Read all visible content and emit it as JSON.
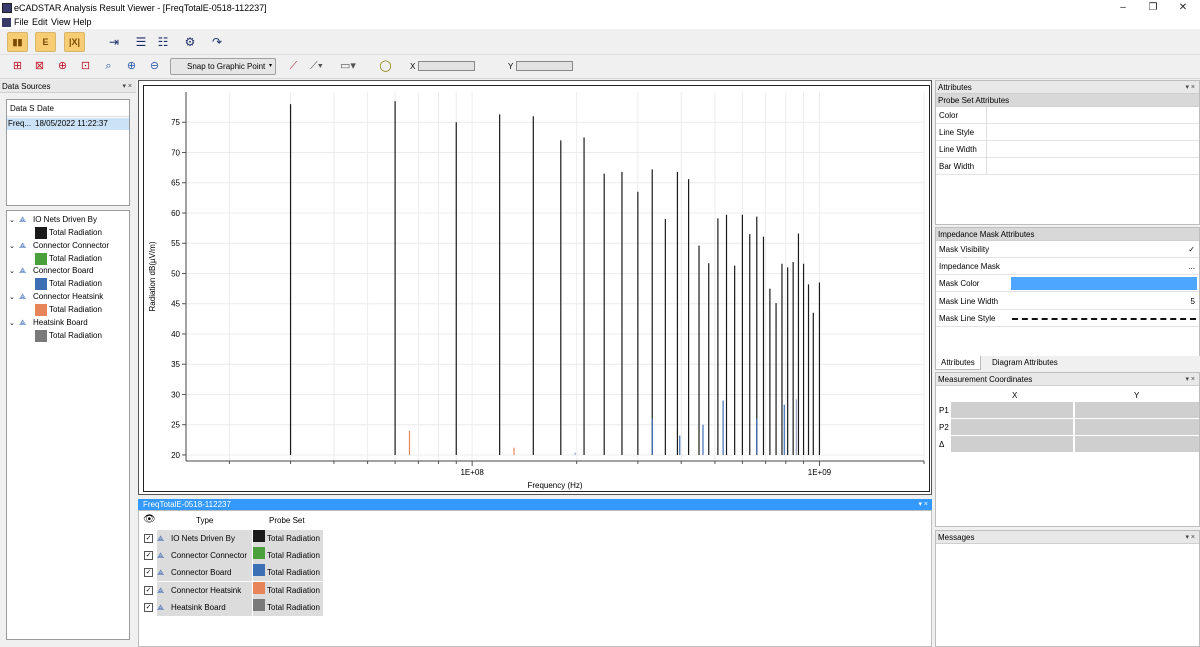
{
  "window": {
    "title": "eCADSTAR Analysis Result Viewer - [FreqTotalE-0518-112237]",
    "controls": [
      "–",
      "❐",
      "✕"
    ]
  },
  "menu": [
    "File",
    "Edit",
    "View",
    "Help"
  ],
  "toolbar2": {
    "snap_label": "Snap to Graphic Point",
    "x_label": "X",
    "y_label": "Y",
    "x_value": "",
    "y_value": ""
  },
  "data_sources": {
    "header": "Data Sources",
    "columns": [
      "Data S",
      "Date"
    ],
    "rows": [
      {
        "name": "Freq...",
        "date": "18/05/2022 11:22:37"
      }
    ]
  },
  "tree": [
    {
      "label": "IO Nets Driven By",
      "child": "Total Radiation",
      "color": "#1a1a1a"
    },
    {
      "label": "Connector Connector",
      "child": "Total Radiation",
      "color": "#4aa03a"
    },
    {
      "label": "Connector Board",
      "child": "Total Radiation",
      "color": "#3d6fb5"
    },
    {
      "label": "Connector Heatsink",
      "child": "Total Radiation",
      "color": "#e8845a"
    },
    {
      "label": "Heatsink Board",
      "child": "Total Radiation",
      "color": "#7a7a7a"
    }
  ],
  "chart_data": {
    "type": "bar",
    "xlabel": "Frequency (Hz)",
    "ylabel": "Radiation dB(µV/m)",
    "xscale": "log",
    "xlim": [
      15000000,
      2000000000
    ],
    "ylim": [
      19,
      80
    ],
    "xticks": [
      {
        "value": 100000000,
        "label": "1E+08"
      },
      {
        "value": 1000000000,
        "label": "1E+09"
      }
    ],
    "yticks": [
      20,
      25,
      30,
      35,
      40,
      45,
      50,
      55,
      60,
      65,
      70,
      75
    ],
    "grid": true,
    "series": [
      {
        "color": "#1a1a1a",
        "x": [
          30000000,
          60000000,
          90000000,
          120000000,
          150000000,
          180000000,
          210000000,
          240000000,
          270000000,
          300000000,
          330000000,
          360000000,
          390000000,
          420000000,
          450000000,
          480000000,
          510000000,
          540000000,
          570000000,
          600000000,
          630000000,
          660000000,
          690000000,
          720000000,
          750000000,
          780000000,
          810000000,
          840000000,
          870000000,
          900000000,
          930000000,
          960000000,
          1000000000
        ],
        "values": [
          78,
          78.5,
          75,
          76.3,
          76,
          72,
          72.5,
          66.5,
          66.8,
          63.5,
          67.2,
          59,
          66.8,
          65.6,
          54.6,
          51.7,
          59.1,
          59.7,
          51.3,
          59.7,
          56.5,
          59.4,
          56.1,
          47.5,
          45.1,
          51.6,
          51,
          51.9,
          56.6,
          51.6,
          48.2,
          43.5,
          48.5
        ]
      },
      {
        "color": "#e8845a",
        "x": [
          66000000,
          132000000
        ],
        "values": [
          24,
          21.2
        ]
      },
      {
        "color": "#3d6fb5",
        "x": [
          330000000,
          396000000,
          462000000,
          528000000,
          660000000,
          792000000
        ],
        "values": [
          26,
          23.2,
          25,
          29,
          26,
          28.3
        ]
      },
      {
        "color": "#9aa8c8",
        "x": [
          198000000,
          858000000
        ],
        "values": [
          20.4,
          29.2
        ]
      }
    ]
  },
  "bottom_table": {
    "header": "FreqTotalE-0518-112237",
    "col_type": "Type",
    "col_probe": "Probe Set",
    "rows": [
      {
        "type": "IO Nets Driven By",
        "probe": "Total Radiation",
        "color": "#1a1a1a",
        "checked": "✓"
      },
      {
        "type": "Connector Connector",
        "probe": "Total Radiation",
        "color": "#4aa03a",
        "checked": "✓"
      },
      {
        "type": "Connector Board",
        "probe": "Total Radiation",
        "color": "#3d6fb5",
        "checked": "✓"
      },
      {
        "type": "Connector Heatsink",
        "probe": "Total Radiation",
        "color": "#e8845a",
        "checked": "✓"
      },
      {
        "type": "Heatsink Board",
        "probe": "Total Radiation",
        "color": "#7a7a7a",
        "checked": "✓"
      }
    ]
  },
  "attributes": {
    "header": "Attributes",
    "section": "Probe Set Attributes",
    "rows": [
      "Color",
      "Line Style",
      "Line Width",
      "Bar Width"
    ]
  },
  "impedance": {
    "header": "Impedance Mask Attributes",
    "rows": [
      {
        "label": "Mask Visibility",
        "value": "✓"
      },
      {
        "label": "Impedance Mask",
        "value": "..."
      },
      {
        "label": "Mask Color",
        "value": ""
      },
      {
        "label": "Mask Line Width",
        "value": "5"
      },
      {
        "label": "Mask Line Style",
        "value": ""
      }
    ],
    "mask_color": "#4da6ff"
  },
  "tabs": [
    "Attributes",
    "Diagram Attributes"
  ],
  "measurement": {
    "header": "Measurement Coordinates",
    "col_x": "X",
    "col_y": "Y",
    "rows": [
      "P1",
      "P2",
      "Δ"
    ]
  },
  "messages": {
    "header": "Messages"
  }
}
